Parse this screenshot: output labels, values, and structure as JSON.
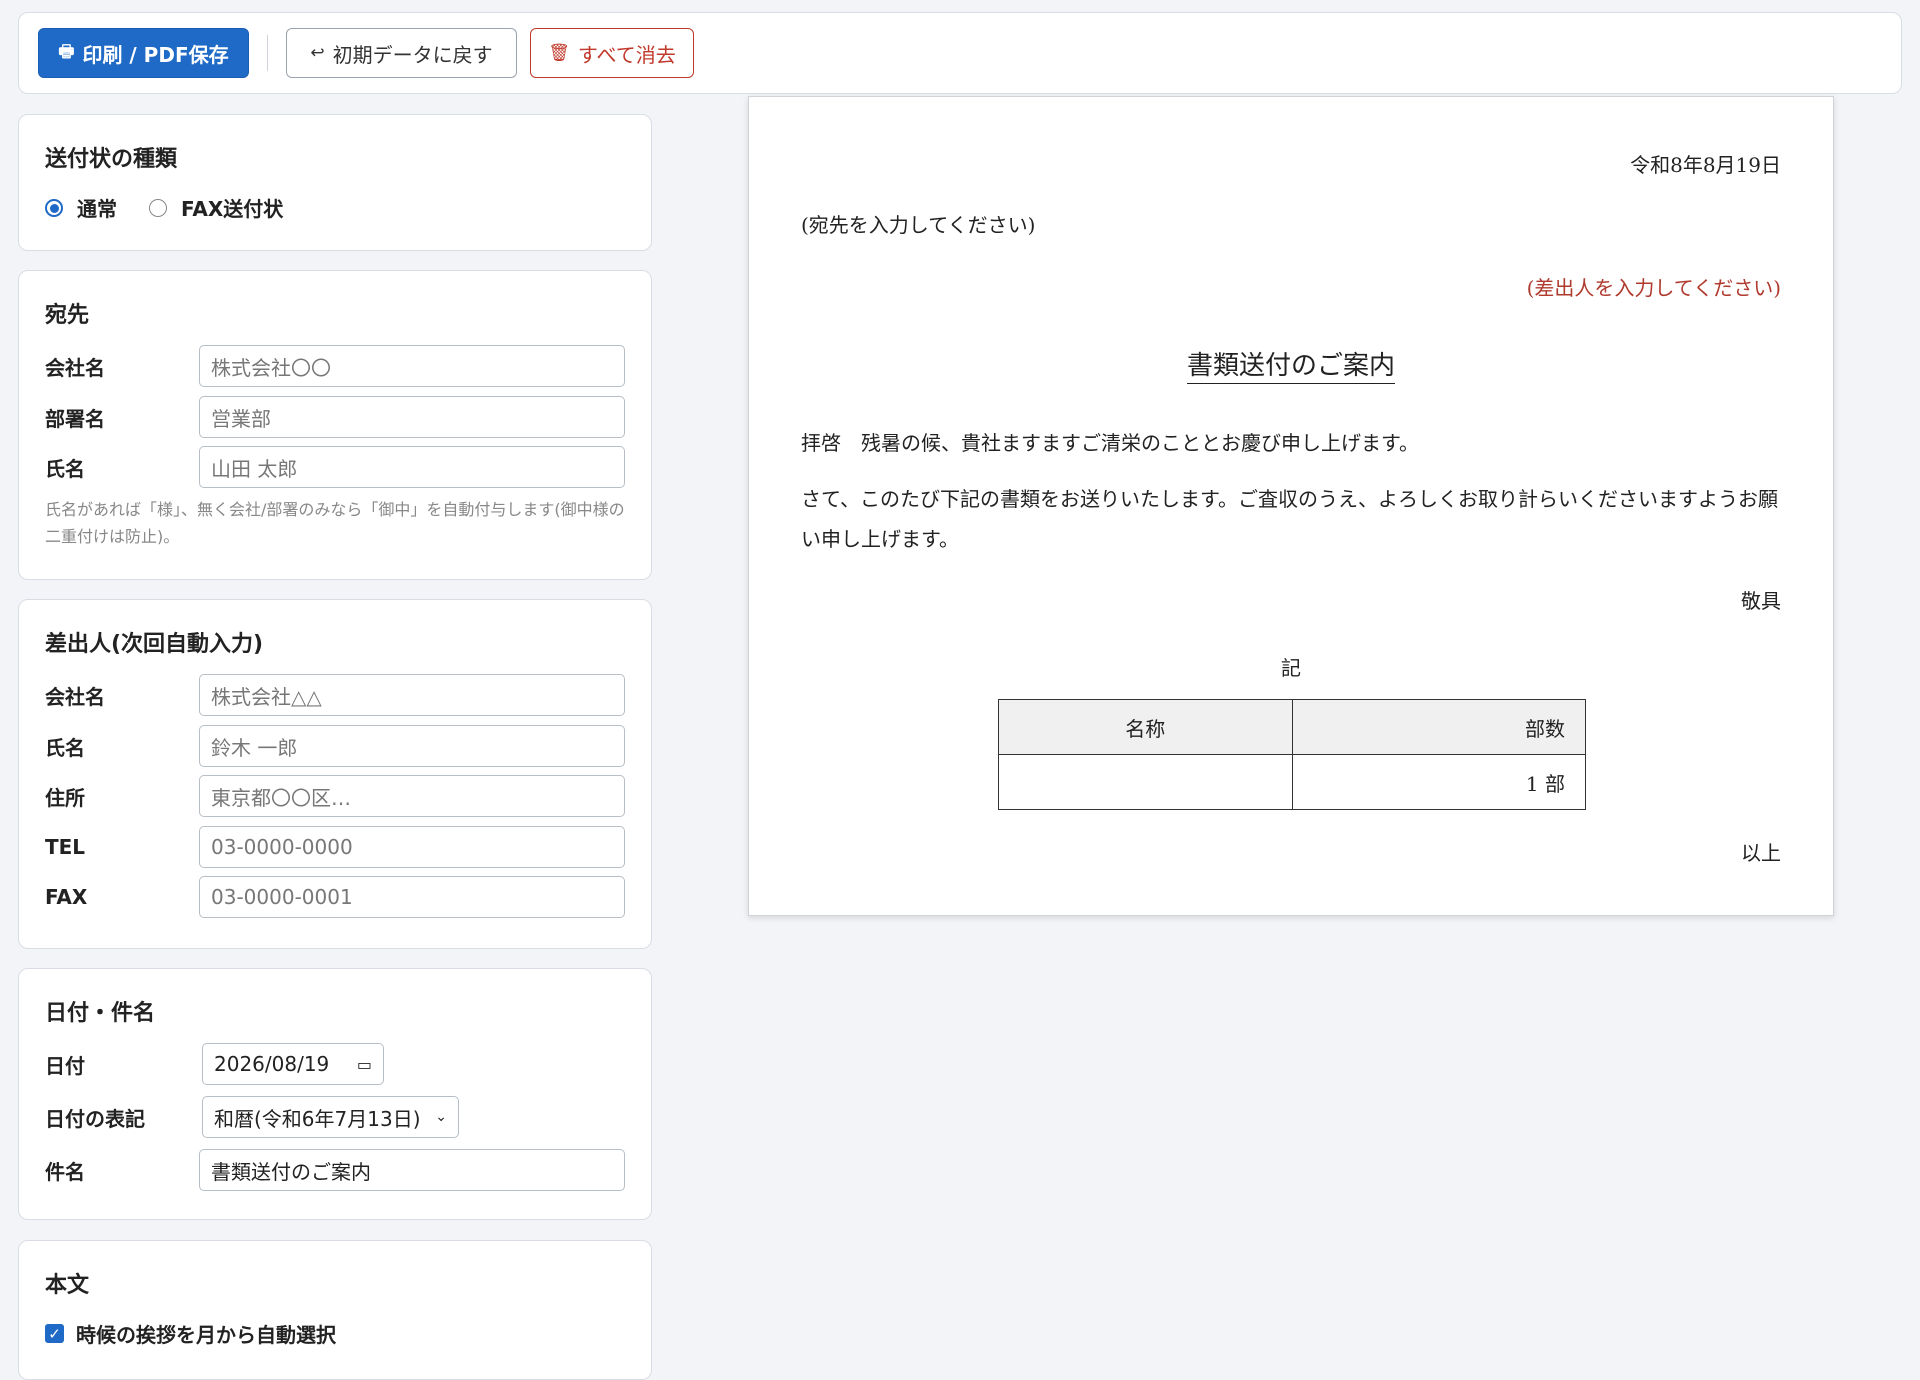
{
  "toolbar": {
    "print_label": "印刷 / PDF保存",
    "print_icon": "printer-icon",
    "reset_label": "初期データに戻す",
    "reset_icon": "return-arrow-icon",
    "clear_label": "すべて消去",
    "clear_icon": "trash-icon"
  },
  "type_panel": {
    "title": "送付状の種類",
    "options": [
      {
        "label": "通常",
        "selected": true
      },
      {
        "label": "FAX送付状",
        "selected": false
      }
    ]
  },
  "recipient": {
    "title": "宛先",
    "company_label": "会社名",
    "company_placeholder": "株式会社〇〇",
    "dept_label": "部署名",
    "dept_placeholder": "営業部",
    "name_label": "氏名",
    "name_placeholder": "山田 太郎",
    "hint": "氏名があれば「様」、無く会社/部署のみなら「御中」を自動付与します(御中様の二重付けは防止)。"
  },
  "sender": {
    "title": "差出人(次回自動入力)",
    "company_label": "会社名",
    "company_placeholder": "株式会社△△",
    "name_label": "氏名",
    "name_placeholder": "鈴木 一郎",
    "address_label": "住所",
    "address_placeholder": "東京都〇〇区…",
    "tel_label": "TEL",
    "tel_placeholder": "03-0000-0000",
    "fax_label": "FAX",
    "fax_placeholder": "03-0000-0001"
  },
  "date_subject": {
    "title": "日付・件名",
    "date_label": "日付",
    "date_value": "2026/08/19",
    "format_label": "日付の表記",
    "format_value": "和暦(令和6年7月13日)",
    "subject_label": "件名",
    "subject_value": "書類送付のご案内"
  },
  "body_panel": {
    "title": "本文",
    "auto_season_label": "時候の挨拶を月から自動選択",
    "auto_season_checked": true
  },
  "preview": {
    "date": "令和8年8月19日",
    "recipient_placeholder": "(宛先を入力してください)",
    "sender_placeholder": "(差出人を入力してください)",
    "sender_color": "#b03a2e",
    "title": "書類送付のご案内",
    "greeting": "拝啓　残暑の候、貴社ますますご清栄のこととお慶び申し上げます。",
    "body": "さて、このたび下記の書類をお送りいたします。ご査収のうえ、よろしくお取り計らいくださいますようお願い申し上げます。",
    "closing": "敬具",
    "ki": "記",
    "table_headers": [
      "名称",
      "部数"
    ],
    "table_rows": [
      [
        "",
        "1 部"
      ]
    ],
    "end": "以上"
  },
  "colors": {
    "accent": "#1f6ac6",
    "danger": "#c0392b"
  }
}
